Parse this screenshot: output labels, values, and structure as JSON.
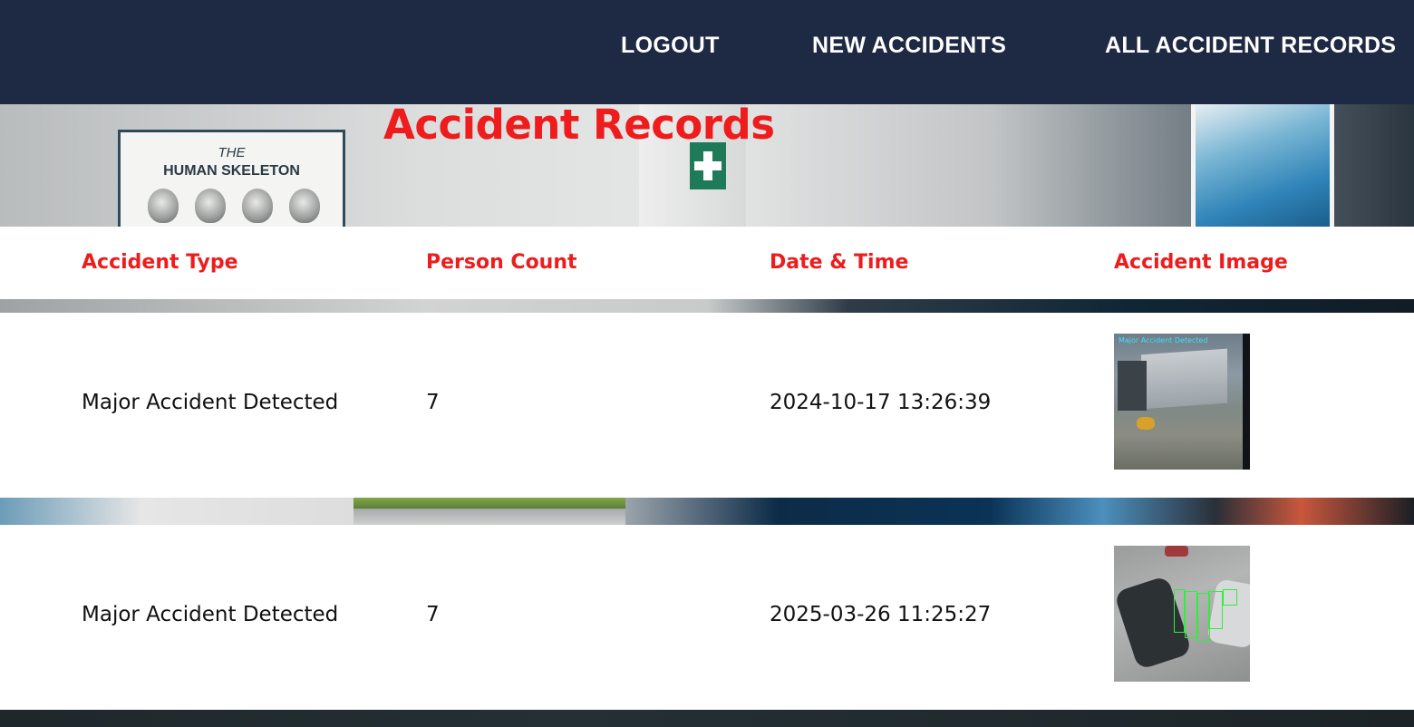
{
  "nav": {
    "logout": "LOGOUT",
    "new_accidents": "NEW ACCIDENTS",
    "all_records": "ALL ACCIDENT RECORDS"
  },
  "page": {
    "title": "Accident Records"
  },
  "background": {
    "poster_line1": "THE",
    "poster_line2": "HUMAN SKELETON"
  },
  "table": {
    "headers": [
      "Accident Type",
      "Person Count",
      "Date & Time",
      "Accident Image"
    ],
    "rows": [
      {
        "type": "Major Accident Detected",
        "count": "7",
        "datetime": "2024-10-17 13:26:39",
        "image_label": "Major Accident Detected"
      },
      {
        "type": "Major Accident Detected",
        "count": "7",
        "datetime": "2025-03-26 11:25:27",
        "image_label": ""
      }
    ]
  },
  "colors": {
    "navbar": "#1e2944",
    "accent_red": "#ee1c1c",
    "detection_box": "#2ef03a"
  }
}
